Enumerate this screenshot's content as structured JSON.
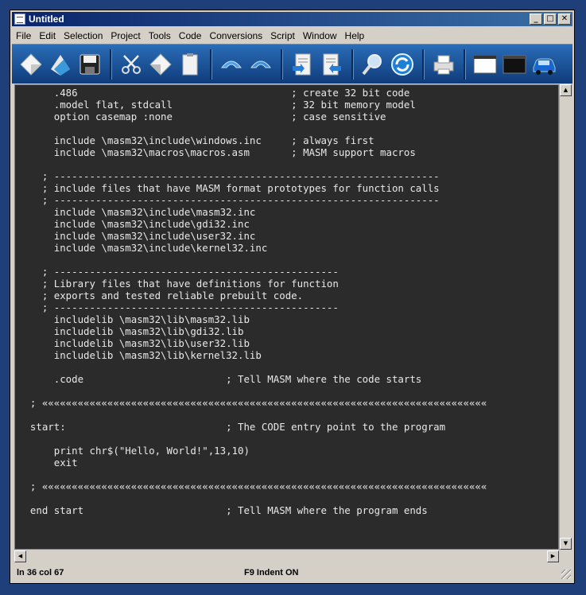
{
  "window": {
    "title": "Untitled"
  },
  "menu": [
    "File",
    "Edit",
    "Selection",
    "Project",
    "Tools",
    "Code",
    "Conversions",
    "Script",
    "Window",
    "Help"
  ],
  "toolbar": {
    "buttons": [
      "new-icon",
      "open-icon",
      "save-icon",
      "cut-icon",
      "copy-icon",
      "paste-icon",
      "undo-icon",
      "redo-icon",
      "import-icon",
      "export-icon",
      "find-icon",
      "refresh-icon",
      "print-icon",
      "window-icon",
      "console-icon",
      "car-icon"
    ]
  },
  "editor": {
    "lines": [
      "      .486                                    ; create 32 bit code",
      "      .model flat, stdcall                    ; 32 bit memory model",
      "      option casemap :none                    ; case sensitive",
      "",
      "      include \\masm32\\include\\windows.inc     ; always first",
      "      include \\masm32\\macros\\macros.asm       ; MASM support macros",
      "",
      "    ; -----------------------------------------------------------------",
      "    ; include files that have MASM format prototypes for function calls",
      "    ; -----------------------------------------------------------------",
      "      include \\masm32\\include\\masm32.inc",
      "      include \\masm32\\include\\gdi32.inc",
      "      include \\masm32\\include\\user32.inc",
      "      include \\masm32\\include\\kernel32.inc",
      "",
      "    ; ------------------------------------------------",
      "    ; Library files that have definitions for function",
      "    ; exports and tested reliable prebuilt code.",
      "    ; ------------------------------------------------",
      "      includelib \\masm32\\lib\\masm32.lib",
      "      includelib \\masm32\\lib\\gdi32.lib",
      "      includelib \\masm32\\lib\\user32.lib",
      "      includelib \\masm32\\lib\\kernel32.lib",
      "",
      "      .code                        ; Tell MASM where the code starts",
      "",
      "  ; «««««««««««««««««««««««««««««««««««««««««««««««««««««««««««««««««««««««««««",
      "",
      "  start:                           ; The CODE entry point to the program",
      "",
      "      print chr$(\"Hello, World!\",13,10)",
      "      exit",
      "",
      "  ; «««««««««««««««««««««««««««««««««««««««««««««««««««««««««««««««««««««««««««",
      "",
      "  end start                        ; Tell MASM where the program ends"
    ]
  },
  "status": {
    "position": "ln 36 col 67",
    "indent": "F9 Indent ON"
  },
  "colors": {
    "editor_bg": "#2b2b2b",
    "editor_fg": "#e8e8e8",
    "titlebar": "#0a246a",
    "toolbar": "#1f5aa6"
  }
}
